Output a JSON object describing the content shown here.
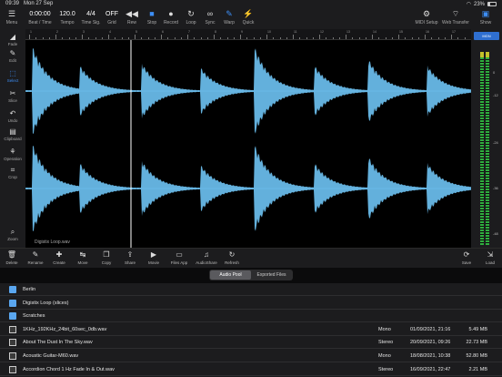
{
  "status": {
    "time": "09:39",
    "date": "Mon 27 Sep",
    "battery": "23%"
  },
  "toolbar": {
    "menu": "Menu",
    "beat_time_value": "0:00:00",
    "beat_time_label": "Beat / Time",
    "tempo_value": "120.0",
    "tempo_label": "Tempo",
    "time_sig_value": "4/4",
    "time_sig_label": "Time Sig.",
    "grid_value": "OFF",
    "grid_label": "Grid",
    "rew": "Rew",
    "stop": "Stop",
    "record": "Record",
    "loop": "Loop",
    "sync": "Sync",
    "warp": "Warp",
    "quick": "Quick",
    "midi_setup": "MIDI Setup",
    "web_transfer": "Web Transfer",
    "show": "Show"
  },
  "ruler_labels": [
    "1",
    "2",
    "3",
    "4",
    "5",
    "6",
    "7",
    "8",
    "9",
    "10",
    "11",
    "12",
    "13",
    "14",
    "15",
    "16",
    "17"
  ],
  "left_tools": [
    "Fade",
    "Edit",
    "Select",
    "Slice",
    "Undo",
    "Clipboard",
    "Operation",
    "Crop",
    "Zoom"
  ],
  "wave": {
    "file_name": "Digistix Loop.wav",
    "color": "#6ec3f4"
  },
  "meter": {
    "button": "MGN",
    "scale": [
      "0",
      "-12",
      "-24",
      "-36",
      "-48"
    ]
  },
  "actions": [
    "Delete",
    "Rename",
    "Create",
    "Move",
    "Copy",
    "Share",
    "Movie",
    "Files App",
    "AudioShare",
    "Refresh",
    "Save",
    "Load"
  ],
  "tabs": {
    "audio_pool": "Audio Pool",
    "exported": "Exported Files"
  },
  "files": [
    {
      "type": "folder",
      "name": "Berlin",
      "ch": "",
      "date": "",
      "size": ""
    },
    {
      "type": "folder",
      "name": "Digistix Loop (slices)",
      "ch": "",
      "date": "",
      "size": ""
    },
    {
      "type": "folder",
      "name": "Scratches",
      "ch": "",
      "date": "",
      "size": ""
    },
    {
      "type": "file",
      "name": "1KHz_192KHz_24bit_60sec_0db.wav",
      "ch": "Mono",
      "date": "01/09/2021, 21:16",
      "size": "5.49 MB"
    },
    {
      "type": "file",
      "name": "About The Dust In The Sky.wav",
      "ch": "Stereo",
      "date": "20/09/2021, 09:26",
      "size": "22.73 MB"
    },
    {
      "type": "file",
      "name": "Acoustic Guitar-M60.wav",
      "ch": "Mono",
      "date": "18/08/2021, 10:38",
      "size": "52.80 MB"
    },
    {
      "type": "file",
      "name": "Accordion Chord 1 Hz Fade In & Out.wav",
      "ch": "Stereo",
      "date": "16/09/2021, 22:47",
      "size": "2.21 MB"
    }
  ]
}
